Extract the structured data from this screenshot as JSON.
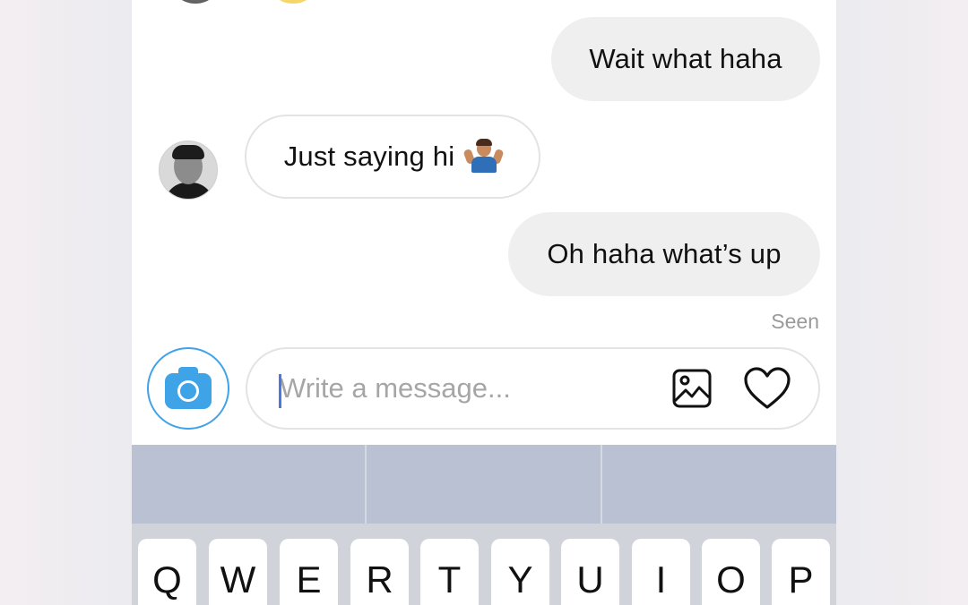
{
  "messages": [
    {
      "direction": "outgoing",
      "text": "Wait what haha"
    },
    {
      "direction": "incoming",
      "text": "Just saying hi",
      "emoji": "shrug-emoji"
    },
    {
      "direction": "outgoing",
      "text": "Oh haha what’s up"
    }
  ],
  "status": {
    "seen": "Seen"
  },
  "composer": {
    "placeholder": "Write a message...",
    "value": "",
    "camera_icon": "camera-icon",
    "gallery_icon": "gallery-icon",
    "like_icon": "heart-icon",
    "accent_color": "#3fa3e8"
  },
  "keyboard": {
    "suggestions": [
      "",
      "",
      ""
    ],
    "row1": [
      "Q",
      "W",
      "E",
      "R",
      "T",
      "Y",
      "U",
      "I",
      "O",
      "P"
    ]
  }
}
